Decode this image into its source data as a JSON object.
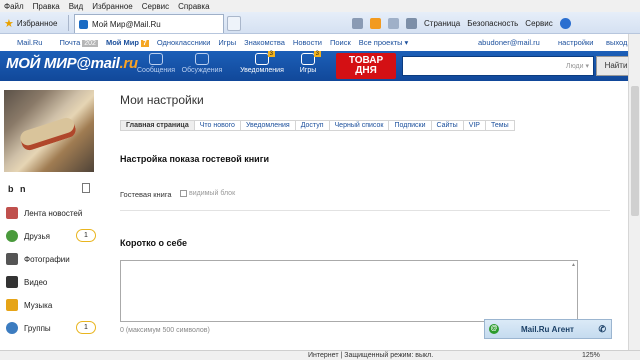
{
  "menubar": [
    "Файл",
    "Правка",
    "Вид",
    "Избранное",
    "Сервис",
    "Справка"
  ],
  "tabbar": {
    "favorites": "Избранное",
    "tab_title": "Мой Мир@Mail.Ru"
  },
  "commands": [
    "Страница",
    "Безопасность",
    "Сервис"
  ],
  "mailnav": {
    "items": [
      "Mail.Ru",
      "Почта",
      "Мой Мир",
      "Одноклассники",
      "Игры",
      "Знакомства",
      "Новости",
      "Поиск",
      "Все проекты"
    ],
    "mail_badge": "202",
    "mymir_badge": "7",
    "email": "abudoner@mail.ru",
    "settings": "настройки",
    "logout": "выход"
  },
  "header": {
    "logo_main": "МОЙ МИР@mail",
    "logo_ru": ".ru",
    "nav": [
      {
        "label": "Сообщения",
        "count": ""
      },
      {
        "label": "Обсуждения",
        "count": ""
      },
      {
        "label": "Уведомления",
        "count": "3"
      },
      {
        "label": "Игры",
        "count": "3"
      }
    ],
    "promo": "ТОВАР\nДНЯ",
    "search_placeholder": "Люди",
    "find_button": "Найти"
  },
  "sidebar": {
    "username": "b n",
    "items": [
      {
        "label": "Лента новостей",
        "icon": "home-icon",
        "count": ""
      },
      {
        "label": "Друзья",
        "icon": "friends-icon",
        "count": "1"
      },
      {
        "label": "Фотографии",
        "icon": "camera-icon",
        "count": ""
      },
      {
        "label": "Видео",
        "icon": "video-icon",
        "count": ""
      },
      {
        "label": "Музыка",
        "icon": "music-icon",
        "count": ""
      },
      {
        "label": "Группы",
        "icon": "groups-icon",
        "count": "1"
      }
    ]
  },
  "main": {
    "title": "Мои настройки",
    "tabs": [
      "Главная страница",
      "Что нового",
      "Уведомления",
      "Доступ",
      "Черный список",
      "Подписки",
      "Сайты",
      "VIP",
      "Темы"
    ],
    "guestbook_heading": "Настройка показа гостевой книги",
    "guestbook_label": "Гостевая книга",
    "guestbook_checkbox": "видимый блок",
    "about_heading": "Коротко о себе",
    "char_limit": "0 (максимум 500 символов)"
  },
  "agent": {
    "label": "Mail.Ru Агент"
  },
  "statusbar": {
    "zone": "Интернет | Защищенный режим: выкл.",
    "zoom": "125%"
  }
}
